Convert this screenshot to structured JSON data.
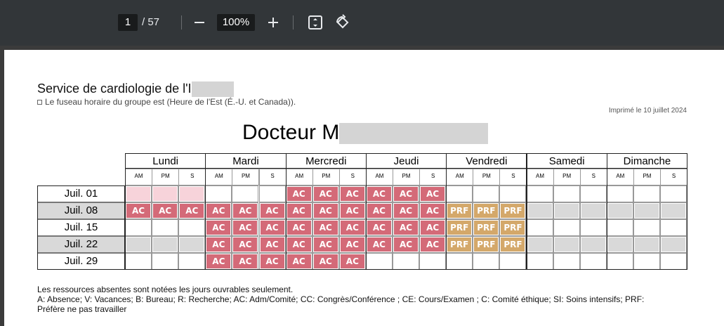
{
  "toolbar": {
    "page_current": "1",
    "page_total": "/ 57",
    "zoom": "100%"
  },
  "document": {
    "department": "Service de cardiologie de l'I",
    "timezone_note": "Le fuseau horaire du groupe est (Heure de l'Est (É.-U. et Canada)).",
    "printed": "Imprimé le 10 juillet 2024",
    "doctor": "Docteur M"
  },
  "schedule": {
    "days": [
      "Lundi",
      "Mardi",
      "Mercredi",
      "Jeudi",
      "Vendredi",
      "Samedi",
      "Dimanche"
    ],
    "slots": [
      "AM",
      "PM",
      "S"
    ],
    "weeks": [
      {
        "label": "Juil. 01",
        "cells": [
          "~",
          "~",
          "~",
          "",
          "",
          "",
          "AC",
          "AC",
          "AC",
          "AC",
          "AC",
          "AC",
          "",
          "",
          "",
          "",
          "",
          "",
          "",
          "",
          ""
        ]
      },
      {
        "label": "Juil. 08",
        "cells": [
          "AC",
          "AC",
          "AC",
          "AC",
          "AC",
          "AC",
          "AC",
          "AC",
          "AC",
          "AC",
          "AC",
          "AC",
          "PRF",
          "PRF",
          "PRF",
          "",
          "",
          "",
          "",
          "",
          ""
        ]
      },
      {
        "label": "Juil. 15",
        "cells": [
          "",
          "",
          "",
          "AC",
          "AC",
          "AC",
          "AC",
          "AC",
          "AC",
          "AC",
          "AC",
          "AC",
          "PRF",
          "PRF",
          "PRF",
          "",
          "",
          "",
          "",
          "",
          ""
        ]
      },
      {
        "label": "Juil. 22",
        "cells": [
          "",
          "",
          "",
          "AC",
          "AC",
          "AC",
          "AC",
          "AC",
          "AC",
          "AC",
          "AC",
          "AC",
          "PRF",
          "PRF",
          "PRF",
          "",
          "",
          "",
          "",
          "",
          ""
        ]
      },
      {
        "label": "Juil. 29",
        "cells": [
          "",
          "",
          "",
          "AC",
          "AC",
          "AC",
          "AC",
          "AC",
          "AC",
          "",
          "",
          "",
          "",
          "",
          "",
          "",
          "",
          "",
          "",
          "",
          ""
        ]
      }
    ],
    "colors": {
      "AC": "#d46a78",
      "PRF": "#d4a86a",
      "light": "#f7d3da",
      "shaded": "#d9d9d9"
    }
  },
  "legend": {
    "line1": "Les ressources absentes sont notées les jours ouvrables seulement.",
    "line2": "A: Absence; V: Vacances; B: Bureau; R: Recherche; AC: Adm/Comité; CC: Congrès/Conférence ; CE: Cours/Examen ; C: Comité éthique; SI: Soins intensifs; PRF: Préfère ne pas travailler"
  }
}
